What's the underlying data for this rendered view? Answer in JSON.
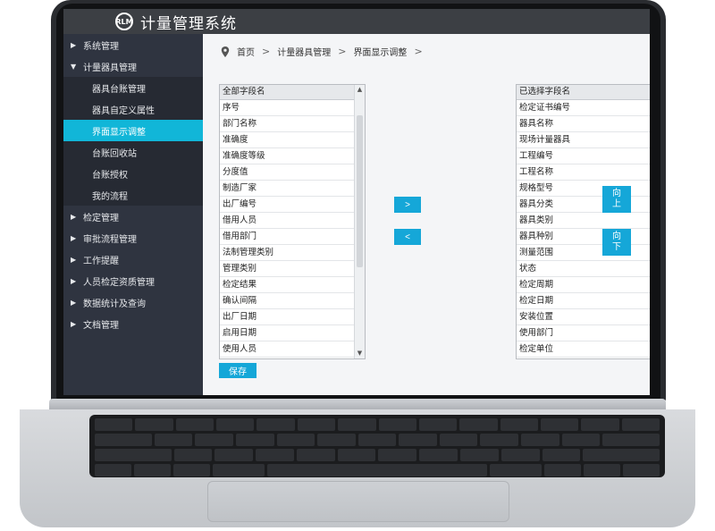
{
  "app": {
    "title": "计量管理系统",
    "logo_text": "RLM"
  },
  "sidebar": {
    "items": [
      {
        "label": "系统管理",
        "expanded": false
      },
      {
        "label": "计量器具管理",
        "expanded": true,
        "children": [
          {
            "label": "器具台账管理"
          },
          {
            "label": "器具自定义属性"
          },
          {
            "label": "界面显示调整",
            "active": true
          },
          {
            "label": "台账回收站"
          },
          {
            "label": "台账授权"
          },
          {
            "label": "我的流程"
          }
        ]
      },
      {
        "label": "检定管理",
        "expanded": false
      },
      {
        "label": "审批流程管理",
        "expanded": false
      },
      {
        "label": "工作提醒",
        "expanded": false
      },
      {
        "label": "人员检定资质管理",
        "expanded": false
      },
      {
        "label": "数据统计及查询",
        "expanded": false
      },
      {
        "label": "文档管理",
        "expanded": false
      }
    ]
  },
  "breadcrumb": [
    "首页",
    "计量器具管理",
    "界面显示调整"
  ],
  "all_fields": {
    "header": "全部字段名",
    "items": [
      "序号",
      "部门名称",
      "准确度",
      "准确度等级",
      "分度值",
      "制造厂家",
      "出厂编号",
      "借用人员",
      "借用部门",
      "法制管理类别",
      "管理类别",
      "检定结果",
      "确认间隔",
      "出厂日期",
      "启用日期",
      "使用人员"
    ]
  },
  "selected_fields": {
    "header": "已选择字段名",
    "items": [
      "检定证书编号",
      "器具名称",
      "现场计量器具",
      "工程编号",
      "工程名称",
      "规格型号",
      "器具分类",
      "器具类别",
      "器具种别",
      "测量范围",
      "状态",
      "检定周期",
      "检定日期",
      "安装位置",
      "使用部门",
      "检定单位"
    ]
  },
  "buttons": {
    "add": ">",
    "remove": "<",
    "move_up": [
      "向",
      "上"
    ],
    "move_down": [
      "向",
      "下"
    ],
    "save": "保存"
  }
}
